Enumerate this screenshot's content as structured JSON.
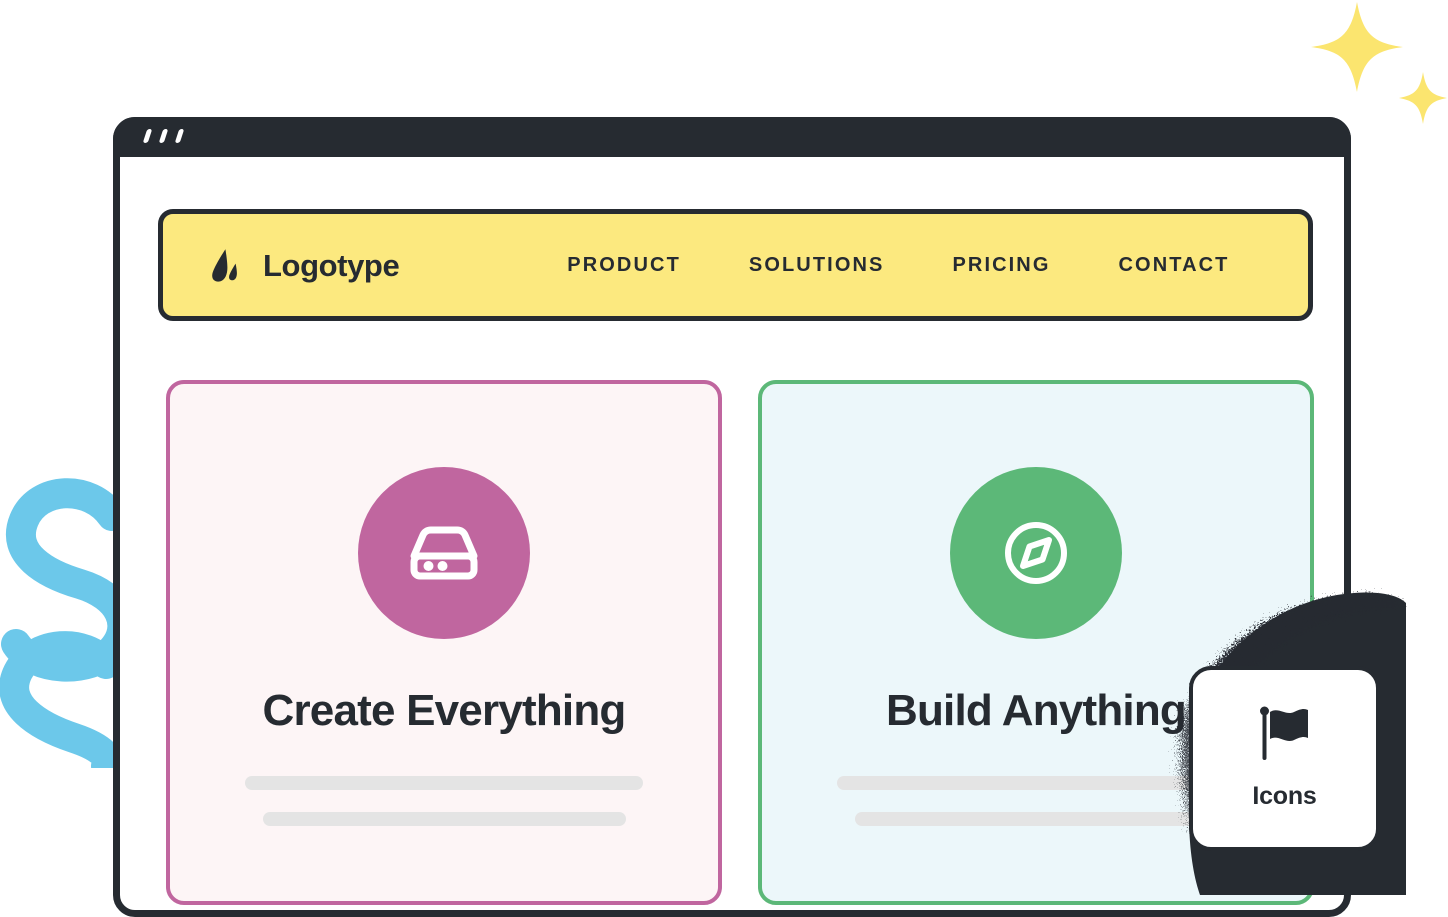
{
  "decor": {
    "sparkle_large": "sparkle-four-point-icon",
    "sparkle_small": "sparkle-four-point-icon",
    "squiggle": "blue-spiral-brush-stroke",
    "ink_splatter": "ink-splatter-shape",
    "colors": {
      "sparkle": "#FBE56F",
      "squiggle": "#6CC8EA",
      "ink": "#262B31"
    }
  },
  "browser": {
    "titlebar": {
      "dots": [
        "dot-1",
        "dot-2",
        "dot-3"
      ],
      "color": "#262B31"
    }
  },
  "navbar": {
    "background_color": "#FCE97F",
    "border_color": "#262B31",
    "brand": {
      "logo_icon": "logotype-mark-icon",
      "name": "Logotype"
    },
    "links": [
      {
        "label": "PRODUCT"
      },
      {
        "label": "SOLUTIONS"
      },
      {
        "label": "PRICING"
      },
      {
        "label": "CONTACT"
      }
    ]
  },
  "cards": [
    {
      "id": "create-everything",
      "title": "Create Everything",
      "icon": "hard-drive-icon",
      "accent_color": "#C0669F",
      "background_color": "#FDF5F6",
      "placeholder_lines": 2
    },
    {
      "id": "build-anything",
      "title": "Build Anything",
      "icon": "compass-icon",
      "accent_color": "#5CB878",
      "background_color": "#ECF7FA",
      "placeholder_lines": 2
    }
  ],
  "icons_card": {
    "icon": "flag-icon",
    "label": "Icons",
    "background_color": "#FFFFFF",
    "border_color": "#262B31"
  }
}
